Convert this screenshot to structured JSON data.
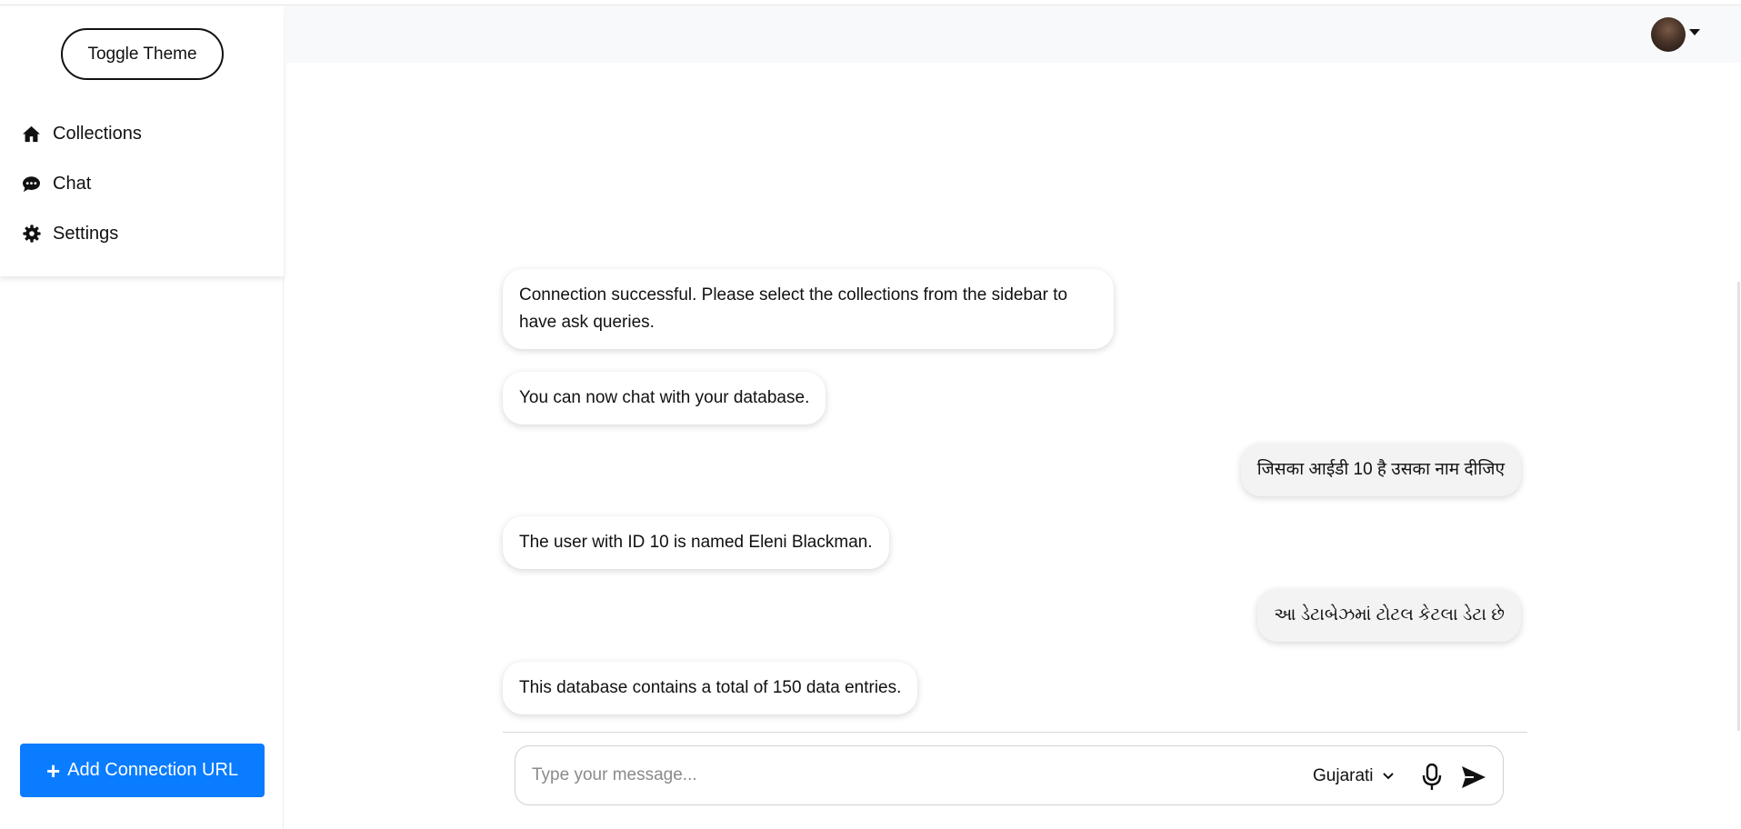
{
  "sidebar": {
    "toggle_label": "Toggle Theme",
    "nav": [
      {
        "label": "Collections",
        "icon": "home-icon"
      },
      {
        "label": "Chat",
        "icon": "chat-bubble-icon"
      },
      {
        "label": "Settings",
        "icon": "gear-icon"
      }
    ],
    "add_connection_label": "Add Connection URL"
  },
  "header": {
    "avatar": "user-avatar"
  },
  "chat": {
    "messages": [
      {
        "role": "bot",
        "text": "Connection successful. Please select the collections from the sidebar to have ask queries."
      },
      {
        "role": "bot",
        "text": "You can now chat with your database."
      },
      {
        "role": "user",
        "text": "जिसका आईडी 10 है उसका नाम दीजिए"
      },
      {
        "role": "bot",
        "text": "The user with ID 10 is named Eleni Blackman."
      },
      {
        "role": "user",
        "text": "આ ડેટાબેઝમાં ટોટલ કેટલા ડેટા છે"
      },
      {
        "role": "bot",
        "text": "This database contains a total of 150 data entries."
      }
    ]
  },
  "composer": {
    "placeholder": "Type your message...",
    "language": "Gujarati"
  },
  "colors": {
    "accent": "#0a7cff",
    "header_bg": "#f8f9fa",
    "user_bubble": "#f3f3f3"
  }
}
